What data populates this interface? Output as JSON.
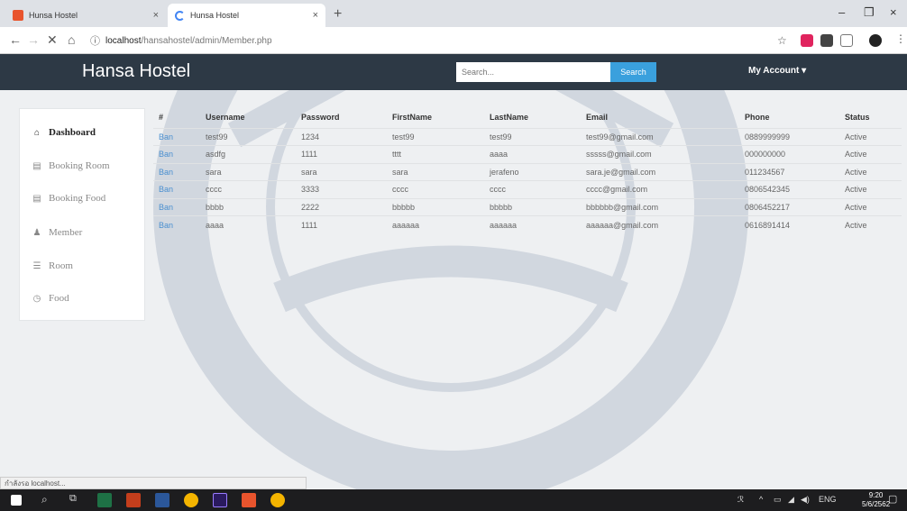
{
  "browser": {
    "tabs": [
      {
        "title": "Hunsa Hostel"
      },
      {
        "title": "Hunsa Hostel"
      }
    ],
    "close_glyph": "×",
    "new_tab_glyph": "+",
    "url_info_glyph": "ⓘ",
    "url_host": "localhost",
    "url_path": "/hansahostel/admin/Member.php",
    "window_controls": {
      "minimize": "–",
      "maximize": "❐",
      "close": "×"
    }
  },
  "header": {
    "brand": "Hansa Hostel",
    "search_placeholder": "Search...",
    "search_button": "Search",
    "account": "My Account ▾"
  },
  "sidebar": {
    "items": [
      {
        "label": "Dashboard",
        "icon": "home-icon",
        "glyph": "⌂",
        "active": true
      },
      {
        "label": "Booking Room",
        "icon": "list-icon",
        "glyph": "▤",
        "active": false
      },
      {
        "label": "Booking Food",
        "icon": "list-icon",
        "glyph": "▤",
        "active": false
      },
      {
        "label": "Member",
        "icon": "user-icon",
        "glyph": "♟",
        "active": false
      },
      {
        "label": "Room",
        "icon": "menu-icon",
        "glyph": "☰",
        "active": false
      },
      {
        "label": "Food",
        "icon": "clock-icon",
        "glyph": "◷",
        "active": false
      }
    ]
  },
  "table": {
    "columns": [
      "#",
      "Username",
      "Password",
      "FirstName",
      "LastName",
      "Email",
      "Phone",
      "Status"
    ],
    "rows": [
      {
        "action": "Ban",
        "username": "test99",
        "password": "1234",
        "firstname": "test99",
        "lastname": "test99",
        "email": "test99@gmail.com",
        "phone": "0889999999",
        "status": "Active"
      },
      {
        "action": "Ban",
        "username": "asdfg",
        "password": "1111",
        "firstname": "tttt",
        "lastname": "aaaa",
        "email": "sssss@gmail.com",
        "phone": "000000000",
        "status": "Active"
      },
      {
        "action": "Ban",
        "username": "sara",
        "password": "sara",
        "firstname": "sara",
        "lastname": "jerafeno",
        "email": "sara.je@gmail.com",
        "phone": "011234567",
        "status": "Active"
      },
      {
        "action": "Ban",
        "username": "cccc",
        "password": "3333",
        "firstname": "cccc",
        "lastname": "cccc",
        "email": "cccc@gmail.com",
        "phone": "0806542345",
        "status": "Active"
      },
      {
        "action": "Ban",
        "username": "bbbb",
        "password": "2222",
        "firstname": "bbbbb",
        "lastname": "bbbbb",
        "email": "bbbbbb@gmail.com",
        "phone": "0806452217",
        "status": "Active"
      },
      {
        "action": "Ban",
        "username": "aaaa",
        "password": "1111",
        "firstname": "aaaaaa",
        "lastname": "aaaaaa",
        "email": "aaaaaa@gmail.com",
        "phone": "0616891414",
        "status": "Active"
      }
    ]
  },
  "status_bar": "กำลังรอ localhost...",
  "taskbar": {
    "lang": "ENG",
    "time": "9:20",
    "date": "5/6/2562"
  },
  "colors": {
    "header_bg": "#2d3945",
    "accent": "#3aa0dd",
    "link": "#4a8fd0"
  }
}
